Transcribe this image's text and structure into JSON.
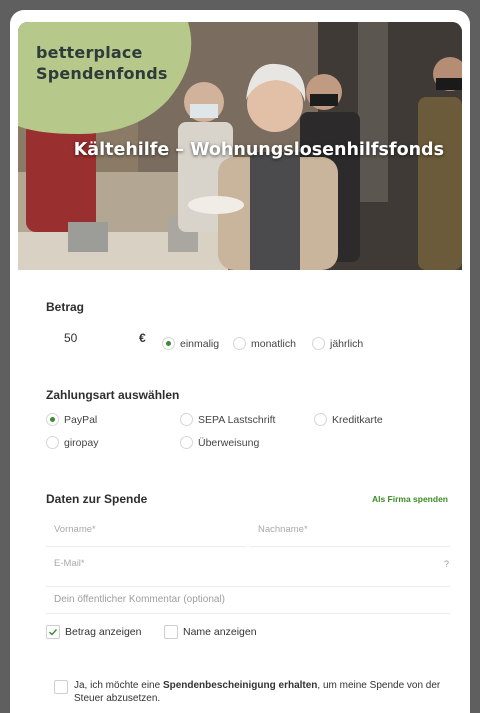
{
  "hero": {
    "brand_line1": "betterplace",
    "brand_line2": "Spendenfonds",
    "title": "Kältehilfe – Wohnungslosenhilfsfonds"
  },
  "amount": {
    "label": "Betrag",
    "value": "50",
    "currency": "€",
    "frequency": [
      {
        "label": "einmalig",
        "selected": true
      },
      {
        "label": "monatlich",
        "selected": false
      },
      {
        "label": "jährlich",
        "selected": false
      }
    ]
  },
  "payment": {
    "label": "Zahlungsart auswählen",
    "options": [
      {
        "label": "PayPal",
        "selected": true
      },
      {
        "label": "SEPA Lastschrift",
        "selected": false
      },
      {
        "label": "Kreditkarte",
        "selected": false
      },
      {
        "label": "giropay",
        "selected": false
      },
      {
        "label": "Überweisung",
        "selected": false
      }
    ]
  },
  "donation": {
    "label": "Daten zur Spende",
    "company_link": "Als Firma spenden",
    "firstname_placeholder": "Vorname*",
    "lastname_placeholder": "Nachname*",
    "email_placeholder": "E-Mail*",
    "email_help": "?",
    "comment_placeholder": "Dein öffentlicher Kommentar (optional)",
    "show_amount": {
      "label": "Betrag anzeigen",
      "checked": true
    },
    "show_name": {
      "label": "Name anzeigen",
      "checked": false
    },
    "receipt_pre": "Ja, ich möchte eine ",
    "receipt_bold": "Spendenbescheinigung erhalten",
    "receipt_post": ", um meine Spende von der Steuer abzusetzen."
  },
  "colors": {
    "accent_green": "#3a8f2d",
    "brand_blob": "#b6c98a"
  }
}
